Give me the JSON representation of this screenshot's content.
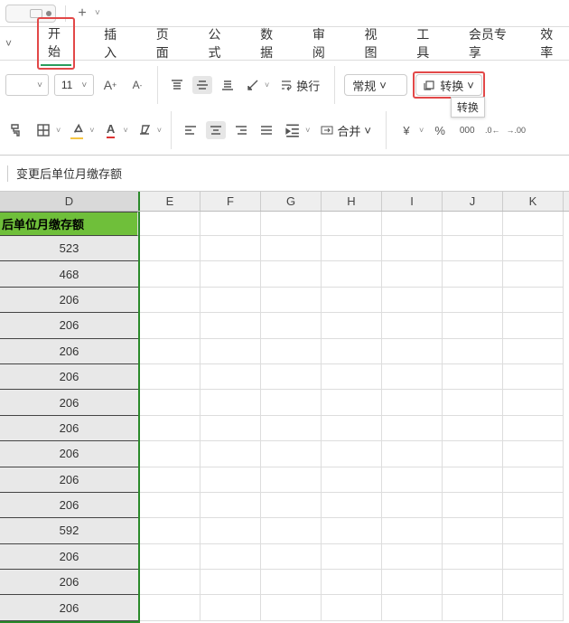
{
  "menu": {
    "items": [
      "开始",
      "插入",
      "页面",
      "公式",
      "数据",
      "审阅",
      "视图",
      "工具",
      "会员专享",
      "效率"
    ],
    "activeIndex": 0
  },
  "ribbon": {
    "fontSize": "11",
    "numberFormat": "常规",
    "wrap": "换行",
    "merge": "合并",
    "convert": "转换",
    "convertTooltip": "转换",
    "currency": "¥",
    "percent": "%"
  },
  "formula": "变更后单位月缴存额",
  "columns": [
    "D",
    "E",
    "F",
    "G",
    "H",
    "I",
    "J",
    "K"
  ],
  "colD": {
    "header": "后单位月缴存额",
    "values": [
      "523",
      "468",
      "206",
      "206",
      "206",
      "206",
      "206",
      "206",
      "206",
      "206",
      "206",
      "592",
      "206",
      "206",
      "206"
    ]
  },
  "chart_data": {
    "type": "table",
    "columns": [
      "变更后单位月缴存额"
    ],
    "values": [
      523,
      468,
      206,
      206,
      206,
      206,
      206,
      206,
      206,
      206,
      206,
      592,
      206,
      206,
      206
    ]
  }
}
